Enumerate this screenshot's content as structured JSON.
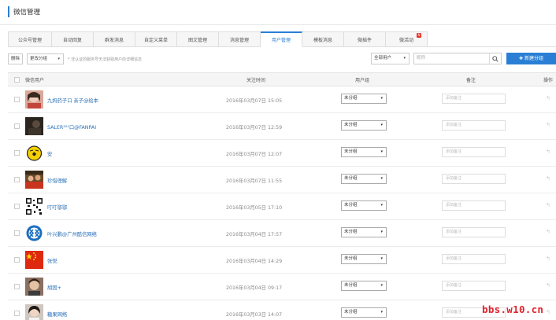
{
  "page_title": "微信管理",
  "tabs": [
    {
      "label": "公众号管理",
      "active": false
    },
    {
      "label": "自动回复",
      "active": false
    },
    {
      "label": "群发消息",
      "active": false
    },
    {
      "label": "自定义菜单",
      "active": false
    },
    {
      "label": "图文管理",
      "active": false
    },
    {
      "label": "消息管理",
      "active": false
    },
    {
      "label": "用户管理",
      "active": true
    },
    {
      "label": "模板消息",
      "active": false
    },
    {
      "label": "微插件",
      "active": false
    },
    {
      "label": "微活动",
      "active": false,
      "badge": "N"
    }
  ],
  "toolbar": {
    "delete_label": "删除",
    "move_group_label": "更改分组",
    "hint": "* 非认证的服务号无法获取用户的详细信息",
    "group_filter": "全部用户",
    "search_placeholder": "昵称",
    "new_group_label": "新建分组"
  },
  "table": {
    "headers": {
      "user": "微信用户",
      "time": "关注时间",
      "group": "用户组",
      "remark": "备注",
      "action": "操作"
    },
    "remark_placeholder": "添加备注",
    "rows": [
      {
        "name": "九妈药子口 亲子@绘本",
        "time": "2016年03月07日 15:05",
        "group": "未分组",
        "avatar": "woman-photo"
      },
      {
        "name": "SALER²⁰¹口@FANPAI",
        "time": "2016年03月07日 12:59",
        "group": "未分组",
        "avatar": "dark-photo"
      },
      {
        "name": "安",
        "time": "2016年03月07日 12:07",
        "group": "未分组",
        "avatar": "yellow-cartoon"
      },
      {
        "name": "珍惜理解",
        "time": "2016年03月07日 11:55",
        "group": "未分组",
        "avatar": "group-photo"
      },
      {
        "name": "叮叮鄂鄂",
        "time": "2016年03月05日 17:10",
        "group": "未分组",
        "avatar": "qr-code"
      },
      {
        "name": "叶兴鹏@广州酷信网络",
        "time": "2016年03月04日 17:57",
        "group": "未分组",
        "avatar": "kx-logo"
      },
      {
        "name": "张悦",
        "time": "2016年03月04日 14:29",
        "group": "未分组",
        "avatar": "china-flag"
      },
      {
        "name": "胡固+",
        "time": "2016年03月04日 09:17",
        "group": "未分组",
        "avatar": "portrait-photo"
      },
      {
        "name": "糖果网络",
        "time": "2016年03月03日 14:07",
        "group": "未分组",
        "avatar": "girl-photo"
      }
    ]
  },
  "watermark": "bbs.w10.cn",
  "colors": {
    "accent": "#2a7fd4",
    "link": "#2a6fb7",
    "badge": "#e5322d",
    "watermark": "#e0242d"
  }
}
